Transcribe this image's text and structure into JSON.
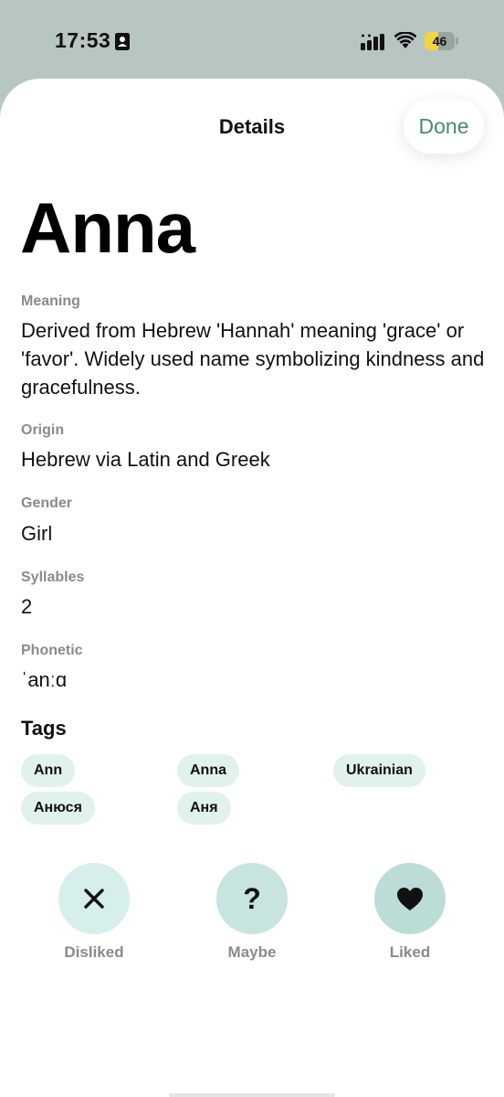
{
  "status_bar": {
    "time": "17:53",
    "battery_level": "46",
    "battery_fraction": 0.46
  },
  "nav": {
    "title": "Details",
    "done_label": "Done"
  },
  "name": "Anna",
  "fields": {
    "meaning": {
      "label": "Meaning",
      "value": "Derived from Hebrew 'Hannah' meaning 'grace' or 'favor'. Widely used name symbolizing kindness and gracefulness."
    },
    "origin": {
      "label": "Origin",
      "value": "Hebrew via Latin and Greek"
    },
    "gender": {
      "label": "Gender",
      "value": "Girl"
    },
    "syllables": {
      "label": "Syllables",
      "value": "2"
    },
    "phonetic": {
      "label": "Phonetic",
      "value": "ˈanːɑ"
    }
  },
  "tags": {
    "heading": "Tags",
    "items": [
      "Ann",
      "Anna",
      "Ukrainian",
      "Анюся",
      "Аня"
    ]
  },
  "actions": {
    "disliked": {
      "label": "Disliked",
      "icon": "close-icon",
      "color": "#d6efec"
    },
    "maybe": {
      "label": "Maybe",
      "icon": "question-icon",
      "color": "#c8e4e0"
    },
    "liked": {
      "label": "Liked",
      "icon": "heart-icon",
      "color": "#bcdcd7"
    }
  },
  "colors": {
    "accent": "#4a8a78",
    "tag_bg": "#e1f1ee",
    "battery": "#f2d43c"
  }
}
